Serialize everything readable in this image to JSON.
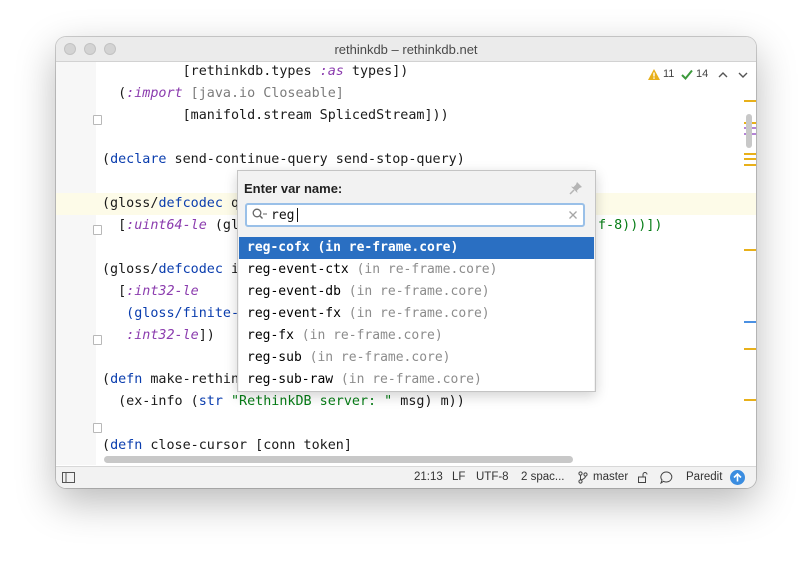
{
  "window": {
    "title": "rethinkdb – rethinkdb.net"
  },
  "code_lines": [
    {
      "parts": [
        {
          "t": "          [rethinkdb.types ",
          "c": ""
        },
        {
          "t": ":as",
          "c": "kwd"
        },
        {
          "t": " types])",
          "c": ""
        }
      ]
    },
    {
      "parts": [
        {
          "t": "  (",
          "c": ""
        },
        {
          "t": ":import",
          "c": "kwd"
        },
        {
          "t": " [java.io Closeable]",
          "c": "gray"
        }
      ]
    },
    {
      "parts": [
        {
          "t": "          [manifold.stream SplicedStream]))",
          "c": ""
        }
      ]
    },
    {
      "parts": []
    },
    {
      "parts": [
        {
          "t": "(",
          "c": ""
        },
        {
          "t": "declare",
          "c": "kw"
        },
        {
          "t": " send-continue-query send-stop-query)",
          "c": ""
        }
      ]
    },
    {
      "parts": []
    },
    {
      "parts": [
        {
          "t": "(gloss/",
          "c": ""
        },
        {
          "t": "defcodec",
          "c": "kw"
        },
        {
          "t": " q",
          "c": ""
        }
      ]
    },
    {
      "parts": [
        {
          "t": "  [",
          "c": ""
        },
        {
          "t": ":uint64-le",
          "c": "kwd"
        },
        {
          "t": " (gl",
          "c": ""
        }
      ]
    },
    {
      "parts": []
    },
    {
      "parts": [
        {
          "t": "(gloss/",
          "c": ""
        },
        {
          "t": "defcodec",
          "c": "kw"
        },
        {
          "t": " i",
          "c": ""
        }
      ]
    },
    {
      "parts": [
        {
          "t": "  [",
          "c": ""
        },
        {
          "t": ":int32-le",
          "c": "kwd"
        }
      ]
    },
    {
      "parts": [
        {
          "t": "   (gloss/finite-",
          "c": "kw"
        }
      ]
    },
    {
      "parts": [
        {
          "t": "   ",
          "c": ""
        },
        {
          "t": ":int32-le",
          "c": "kwd"
        },
        {
          "t": "])",
          "c": ""
        }
      ]
    },
    {
      "parts": []
    },
    {
      "parts": [
        {
          "t": "(",
          "c": ""
        },
        {
          "t": "defn",
          "c": "kw"
        },
        {
          "t": " make-rethin",
          "c": ""
        }
      ]
    },
    {
      "parts": [
        {
          "t": "  (ex-info (",
          "c": ""
        },
        {
          "t": "str",
          "c": "kw"
        },
        {
          "t": " ",
          "c": ""
        },
        {
          "t": "\"RethinkDB server: \"",
          "c": "str"
        },
        {
          "t": " msg) m))",
          "c": ""
        }
      ]
    },
    {
      "parts": []
    },
    {
      "parts": [
        {
          "t": "(",
          "c": ""
        },
        {
          "t": "defn",
          "c": "kw"
        },
        {
          "t": " close-cursor [conn token]",
          "c": ""
        }
      ]
    }
  ],
  "right_fragment": "f-8)))])",
  "inspections": {
    "warnings": "11",
    "ok": "14"
  },
  "popup": {
    "title": "Enter var name:",
    "query": "reg",
    "results": [
      {
        "name": "reg-cofx",
        "ns": "(in re-frame.core)",
        "selected": true
      },
      {
        "name": "reg-event-ctx",
        "ns": "(in re-frame.core)",
        "selected": false
      },
      {
        "name": "reg-event-db",
        "ns": "(in re-frame.core)",
        "selected": false
      },
      {
        "name": "reg-event-fx",
        "ns": "(in re-frame.core)",
        "selected": false
      },
      {
        "name": "reg-fx",
        "ns": "(in re-frame.core)",
        "selected": false
      },
      {
        "name": "reg-sub",
        "ns": "(in re-frame.core)",
        "selected": false
      },
      {
        "name": "reg-sub-raw",
        "ns": "(in re-frame.core)",
        "selected": false
      }
    ]
  },
  "statusbar": {
    "position": "21:13",
    "line_sep": "LF",
    "encoding": "UTF-8",
    "indent": "2 spac...",
    "branch": "master",
    "paredit": "Paredit"
  },
  "colors": {
    "accent": "#2a6fc2",
    "warning": "#e8b01a",
    "ok": "#3c9a3c"
  }
}
